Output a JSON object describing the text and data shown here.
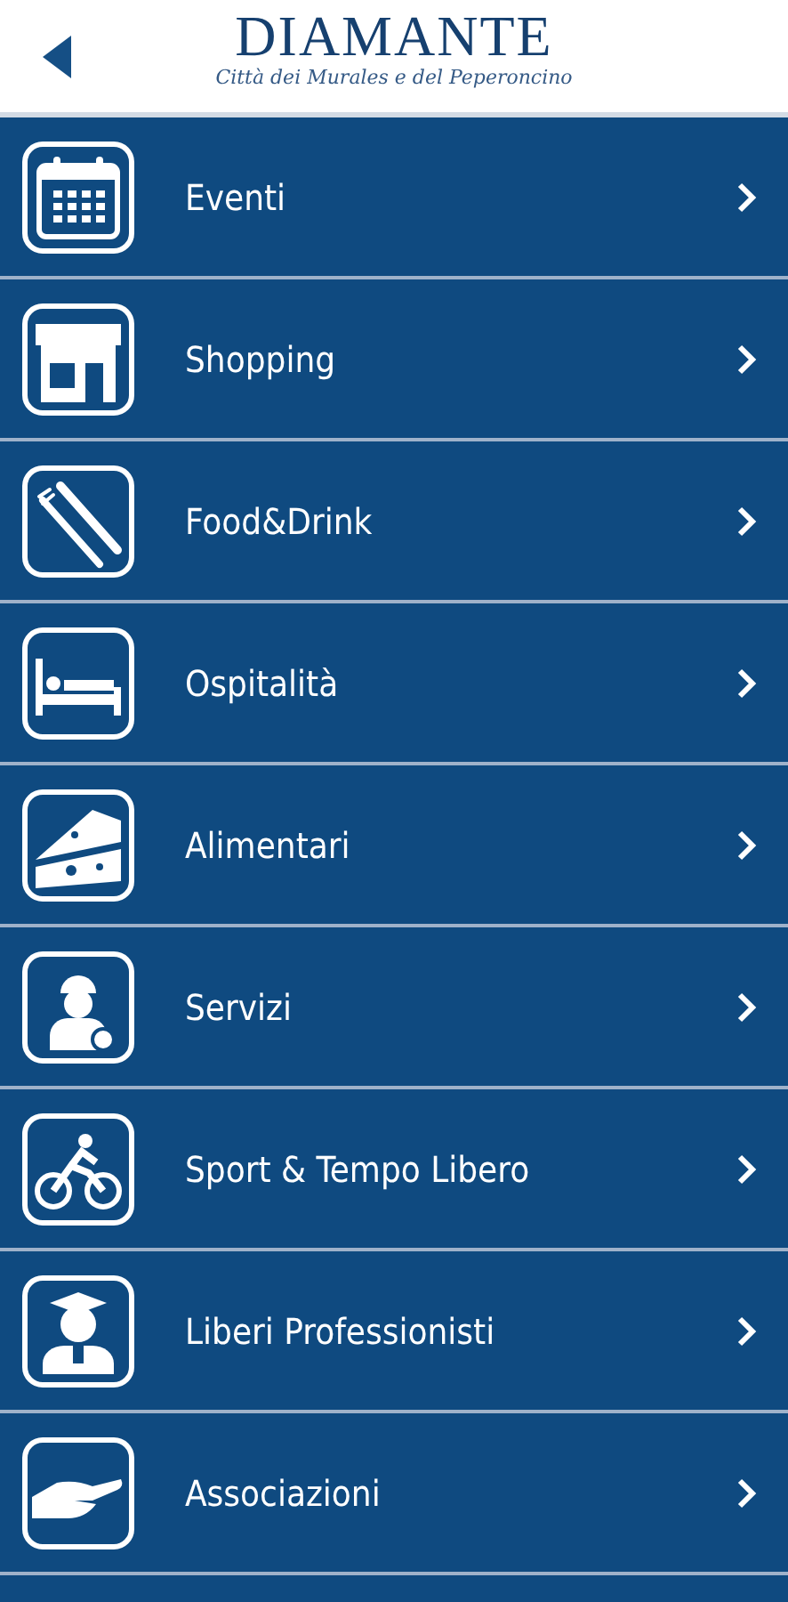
{
  "header": {
    "title": "DIAMANTE",
    "subtitle": "Città dei Murales e del Peperoncino"
  },
  "items": [
    {
      "label": "Eventi"
    },
    {
      "label": "Shopping"
    },
    {
      "label": "Food&Drink"
    },
    {
      "label": "Ospitalità"
    },
    {
      "label": "Alimentari"
    },
    {
      "label": "Servizi"
    },
    {
      "label": "Sport & Tempo Libero"
    },
    {
      "label": "Liberi Professionisti"
    },
    {
      "label": "Associazioni"
    }
  ]
}
